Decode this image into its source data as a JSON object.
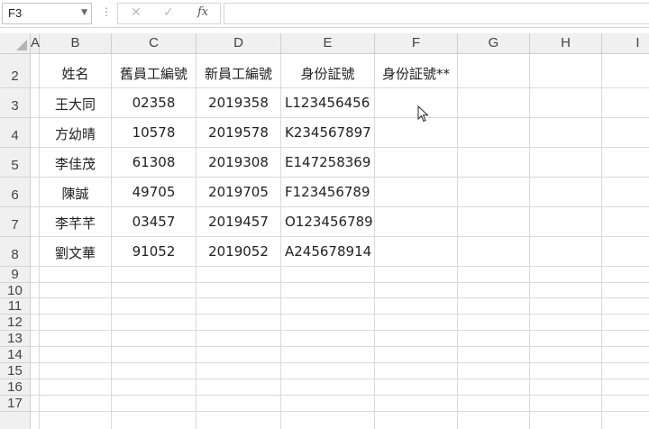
{
  "formula_bar": {
    "name_box": "F3",
    "cancel_icon": "✕",
    "enter_icon": "✓",
    "fx_label": "fx",
    "formula": ""
  },
  "columns": [
    "A",
    "B",
    "C",
    "D",
    "E",
    "F",
    "G",
    "H",
    "I"
  ],
  "rows": [
    "2",
    "3",
    "4",
    "5",
    "6",
    "7",
    "8",
    "9",
    "10",
    "11",
    "12",
    "13",
    "14",
    "15",
    "16",
    "17"
  ],
  "table": {
    "headers": [
      "姓名",
      "舊員工編號",
      "新員工編號",
      "身份証號",
      "身份証號**"
    ],
    "data": [
      [
        "王大同",
        "02358",
        "2019358",
        "L123456456",
        ""
      ],
      [
        "方幼晴",
        "10578",
        "2019578",
        "K234567897",
        ""
      ],
      [
        "李佳茂",
        "61308",
        "2019308",
        "E147258369",
        ""
      ],
      [
        "陳誠",
        "49705",
        "2019705",
        "F123456789",
        ""
      ],
      [
        "李芊芊",
        "03457",
        "2019457",
        "O123456789",
        ""
      ],
      [
        "劉文華",
        "91052",
        "2019052",
        "A245678914",
        ""
      ]
    ]
  }
}
